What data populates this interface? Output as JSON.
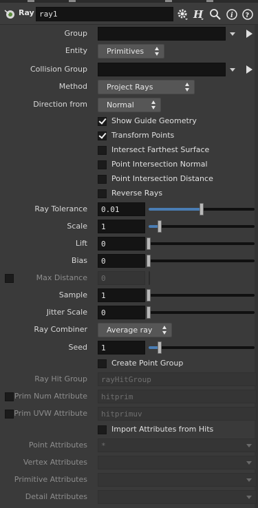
{
  "header": {
    "node_type": "Ray",
    "node_name": "ray1",
    "icons": [
      "node-ray-icon",
      "gear-icon",
      "houdini-help-icon",
      "search-icon",
      "info-icon",
      "help-icon"
    ]
  },
  "params": {
    "group": {
      "label": "Group",
      "value": ""
    },
    "entity": {
      "label": "Entity",
      "value": "Primitives"
    },
    "collision_group": {
      "label": "Collision Group",
      "value": ""
    },
    "method": {
      "label": "Method",
      "value": "Project Rays"
    },
    "direction_from": {
      "label": "Direction from",
      "value": "Normal"
    },
    "show_guide": {
      "label": "Show Guide Geometry",
      "checked": true
    },
    "transform_points": {
      "label": "Transform Points",
      "checked": true
    },
    "intersect_farthest": {
      "label": "Intersect Farthest Surface",
      "checked": false
    },
    "point_int_normal": {
      "label": "Point Intersection Normal",
      "checked": false
    },
    "point_int_distance": {
      "label": "Point Intersection Distance",
      "checked": false
    },
    "reverse_rays": {
      "label": "Reverse Rays",
      "checked": false
    },
    "ray_tolerance": {
      "label": "Ray Tolerance",
      "value": "0.01",
      "slider": 0.5
    },
    "scale": {
      "label": "Scale",
      "value": "1",
      "slider": 0.1
    },
    "lift": {
      "label": "Lift",
      "value": "0",
      "slider": 0
    },
    "bias": {
      "label": "Bias",
      "value": "0",
      "slider": 0
    },
    "max_distance": {
      "label": "Max Distance",
      "value": "0",
      "enabled": false
    },
    "sample": {
      "label": "Sample",
      "value": "1",
      "slider": 0
    },
    "jitter_scale": {
      "label": "Jitter Scale",
      "value": "0",
      "slider": 0
    },
    "ray_combiner": {
      "label": "Ray Combiner",
      "value": "Average ray"
    },
    "seed": {
      "label": "Seed",
      "value": "1",
      "slider": 0.1
    },
    "create_point_group": {
      "label": "Create Point Group",
      "checked": false
    },
    "ray_hit_group": {
      "label": "Ray Hit Group",
      "value": "rayHitGroup"
    },
    "prim_num_attr": {
      "label": "Prim Num Attribute",
      "value": "hitprim"
    },
    "prim_uvw_attr": {
      "label": "Prim UVW Attribute",
      "value": "hitprimuv"
    },
    "import_attrs": {
      "label": "Import Attributes from Hits",
      "checked": false
    },
    "point_attrs": {
      "label": "Point Attributes",
      "value": "*"
    },
    "vertex_attrs": {
      "label": "Vertex Attributes",
      "value": ""
    },
    "primitive_attrs": {
      "label": "Primitive Attributes",
      "value": ""
    },
    "detail_attrs": {
      "label": "Detail Attributes",
      "value": ""
    }
  },
  "colors": {
    "background": "#3a3a3a",
    "field": "#141414",
    "slider_fill": "#4a7db4",
    "menu": "#565656"
  }
}
